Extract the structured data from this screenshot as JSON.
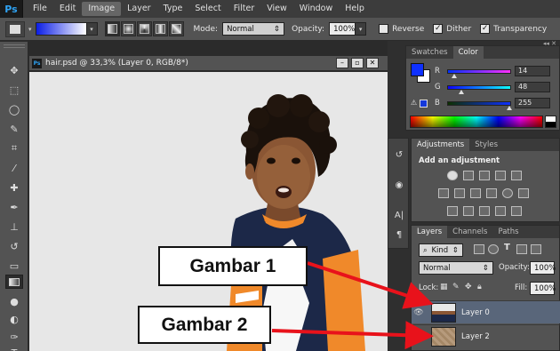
{
  "app": {
    "logo": "Ps"
  },
  "menu": [
    "File",
    "Edit",
    "Image",
    "Layer",
    "Type",
    "Select",
    "Filter",
    "View",
    "Window",
    "Help"
  ],
  "options": {
    "mode_label": "Mode:",
    "mode_value": "Normal",
    "opacity_label": "Opacity:",
    "opacity_value": "100%",
    "reverse_label": "Reverse",
    "dither_label": "Dither",
    "transparency_label": "Transparency"
  },
  "document": {
    "title": "hair.psd @ 33,3% (Layer 0, RGB/8*)"
  },
  "color_panel": {
    "tabs": [
      "Swatches",
      "Color"
    ],
    "active_tab": "Color",
    "channels": [
      {
        "label": "R",
        "value": "14",
        "fraction": 0.055
      },
      {
        "label": "G",
        "value": "48",
        "fraction": 0.188
      },
      {
        "label": "B",
        "value": "255",
        "fraction": 1.0
      }
    ],
    "foreground_color": "#0e30ff"
  },
  "adjustments_panel": {
    "tabs": [
      "Adjustments",
      "Styles"
    ],
    "heading": "Add an adjustment"
  },
  "layers_panel": {
    "tabs": [
      "Layers",
      "Channels",
      "Paths"
    ],
    "kind_label": "Kind",
    "blend_mode": "Normal",
    "opacity_label": "Opacity:",
    "opacity_value": "100%",
    "lock_label": "Lock:",
    "fill_label": "Fill:",
    "fill_value": "100%",
    "layers": [
      {
        "name": "Layer 0",
        "selected": true,
        "visible": true
      },
      {
        "name": "Layer 2",
        "selected": false,
        "visible": true
      }
    ]
  },
  "annotations": [
    {
      "text": "Gambar 1"
    },
    {
      "text": "Gambar 2"
    }
  ],
  "colors": {
    "accent": "#2fa3f4",
    "arrow": "#e8121b",
    "selection": "#59667a"
  }
}
